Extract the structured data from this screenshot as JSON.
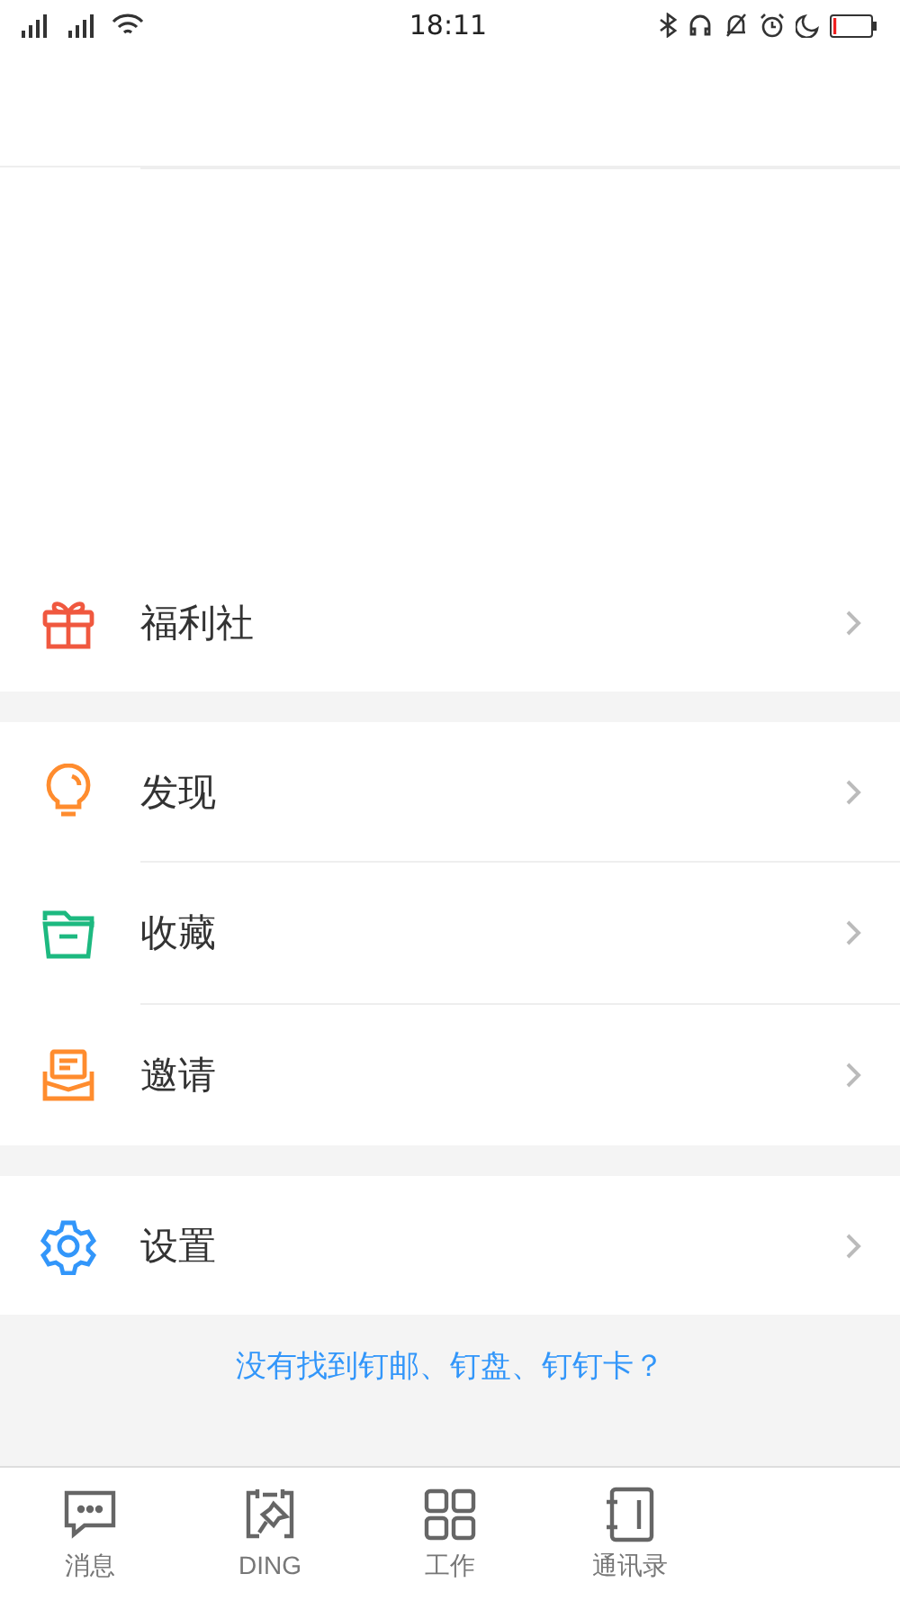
{
  "status_bar": {
    "time": "18:11"
  },
  "sections": [
    [
      {
        "kind": "gift",
        "label": "福利社"
      }
    ],
    [
      {
        "kind": "bulb",
        "label": "发现"
      },
      {
        "kind": "folder",
        "label": "收藏"
      },
      {
        "kind": "invite",
        "label": "邀请"
      }
    ],
    [
      {
        "kind": "gear",
        "label": "设置"
      }
    ]
  ],
  "link": "没有找到钉邮、钉盘、钉钉卡？",
  "tabs": [
    {
      "kind": "chat",
      "label": "消息"
    },
    {
      "kind": "pin",
      "label": "DING"
    },
    {
      "kind": "grid",
      "label": "工作"
    },
    {
      "kind": "book",
      "label": "通讯录"
    }
  ]
}
